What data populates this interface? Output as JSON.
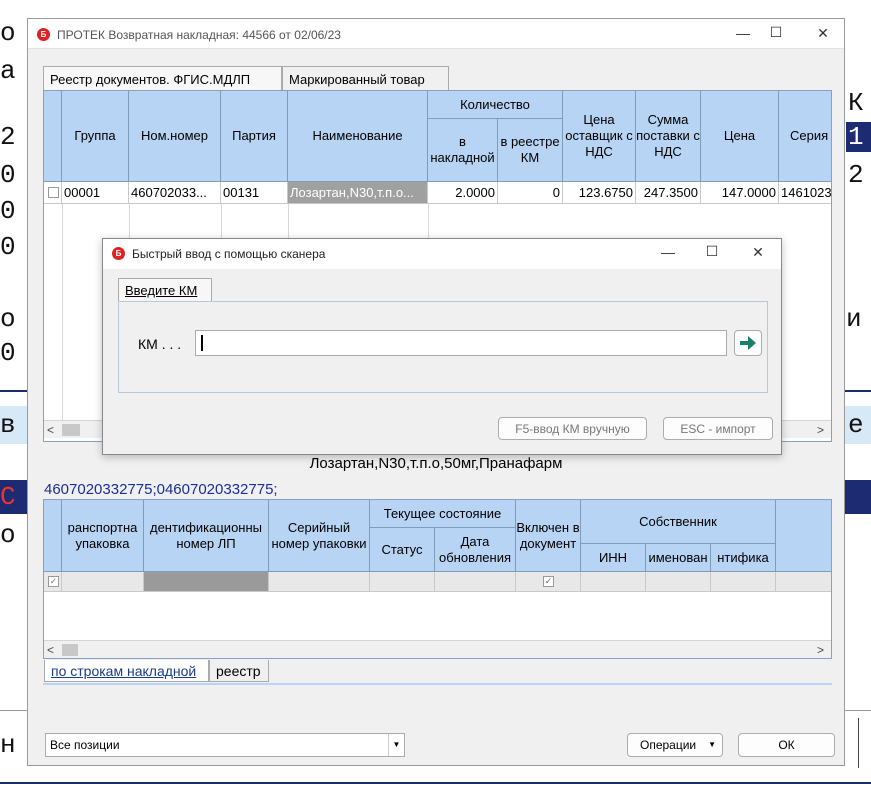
{
  "background": {
    "left_chars": [
      "о",
      "а",
      "2",
      "0",
      "0",
      "0",
      "о",
      "0",
      "в",
      "С",
      "о",
      "н"
    ],
    "right_chars": [
      "К",
      "1",
      "2",
      "и",
      "е"
    ]
  },
  "window": {
    "title": "ПРОТЕК Возвратная накладная: 44566 от 02/06/23",
    "icon_letter": "Б",
    "minimize": "—",
    "maximize": "☐",
    "close": "✕"
  },
  "top_tabs": [
    {
      "label": "Реестр документов. ФГИС.МДЛП"
    },
    {
      "label": "Маркированный товар"
    }
  ],
  "grid1": {
    "headers": {
      "group": "Группа",
      "nom": "Ном.номер",
      "party": "Партия",
      "name": "Наименование",
      "qty": "Количество",
      "qty_inv": "в накладной",
      "qty_reg": "в реестре КМ",
      "price_nds": "Цена оставщик с НДС",
      "sum_nds": "Сумма поставки с НДС",
      "price": "Цена",
      "series": "Серия"
    },
    "row": {
      "group": "00001",
      "nom": "460702033...",
      "party": "00131",
      "name": "Лозартан,N30,т.п.о...",
      "qty_inv": "2.0000",
      "qty_reg": "0",
      "price_nds": "123.6750",
      "sum_nds": "247.3500",
      "price": "147.0000",
      "series": "1461023"
    }
  },
  "product_line": "Лозартан,N30,т.п.о,50мг,Пранафарм",
  "codes_line": "4607020332775;04607020332775;",
  "grid2": {
    "headers": {
      "transport": "ранспортна упаковка",
      "ident": "дентификационны номер ЛП",
      "serial": "Серийный номер упаковки",
      "state": "Текущее состояние",
      "status": "Статус",
      "date": "Дата обновления",
      "included": "Включен в документ",
      "owner": "Собственник",
      "inn": "ИНН",
      "oname": "именован",
      "oident": "нтифика"
    }
  },
  "bottom_tabs": [
    {
      "label": "по строкам накладной"
    },
    {
      "label": "реестр"
    }
  ],
  "footer": {
    "filter_value": "Все позиции",
    "operations_label": "Операции",
    "ok_label": "ОК"
  },
  "dialog": {
    "title": "Быстрый ввод с помощью сканера",
    "icon_letter": "Б",
    "tab_label": "Введите КМ",
    "km_label": "КМ . . .",
    "km_value": "",
    "manual_button": "F5-ввод КМ вручную",
    "import_button": "ESC - импорт"
  }
}
